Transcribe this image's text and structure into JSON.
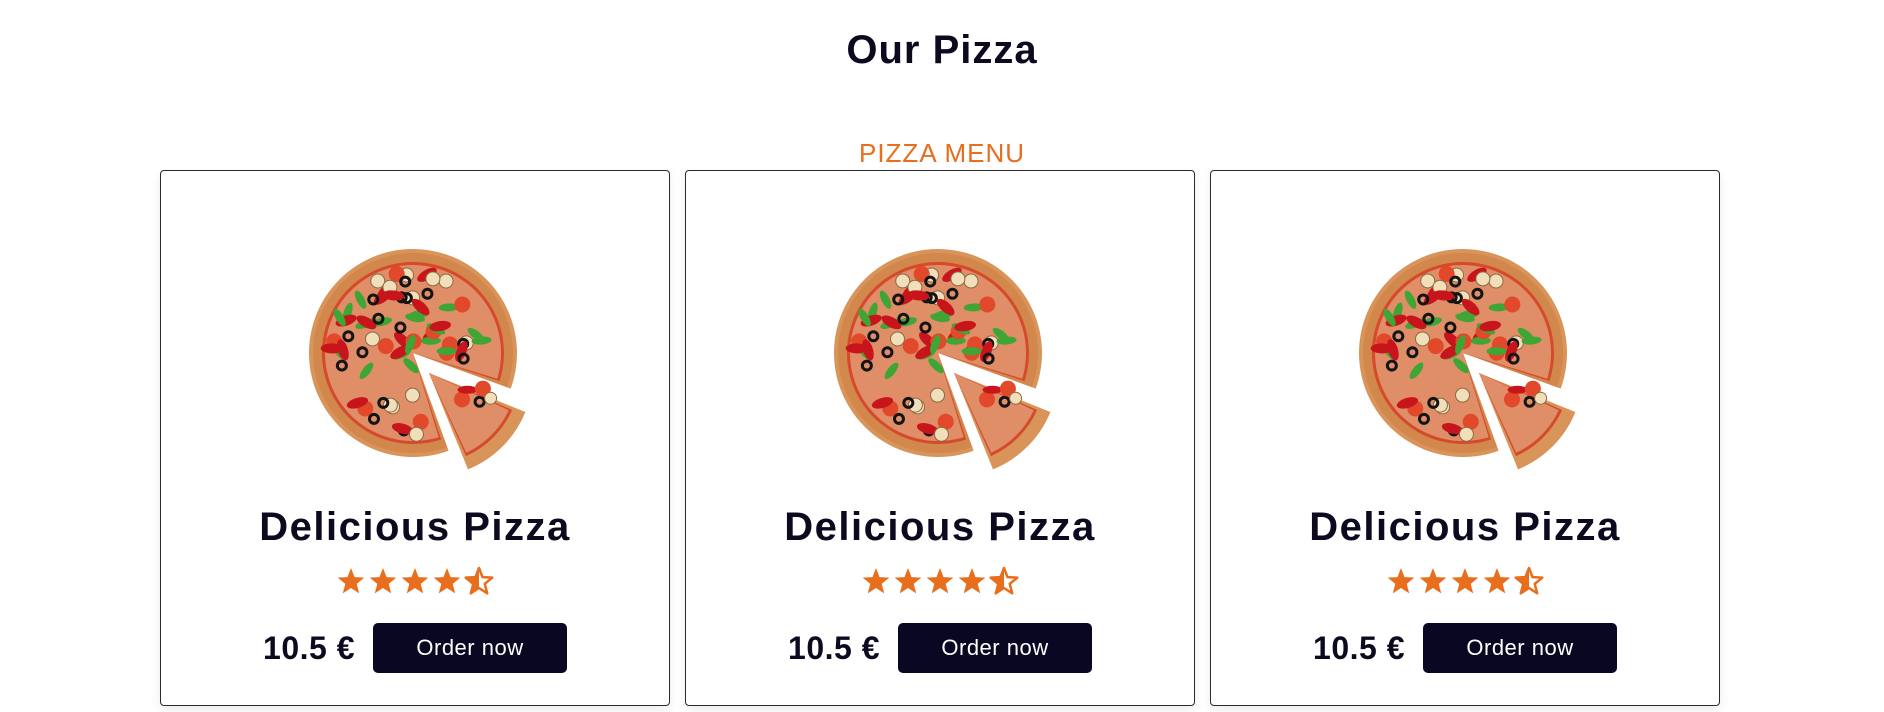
{
  "page": {
    "title": "Our Pizza",
    "section_label": "PIZZA MENU"
  },
  "colors": {
    "accent": "#e86d1c",
    "dark": "#0a0722",
    "text": "#0d0a1f"
  },
  "cards": [
    {
      "name": "Delicious Pizza",
      "rating": 4.5,
      "rating_max": 5,
      "price": "10.5 €",
      "button_label": "Order now",
      "image_icon": "pizza-image"
    },
    {
      "name": "Delicious Pizza",
      "rating": 4.5,
      "rating_max": 5,
      "price": "10.5 €",
      "button_label": "Order now",
      "image_icon": "pizza-image"
    },
    {
      "name": "Delicious Pizza",
      "rating": 4.5,
      "rating_max": 5,
      "price": "10.5 €",
      "button_label": "Order now",
      "image_icon": "pizza-image"
    }
  ]
}
